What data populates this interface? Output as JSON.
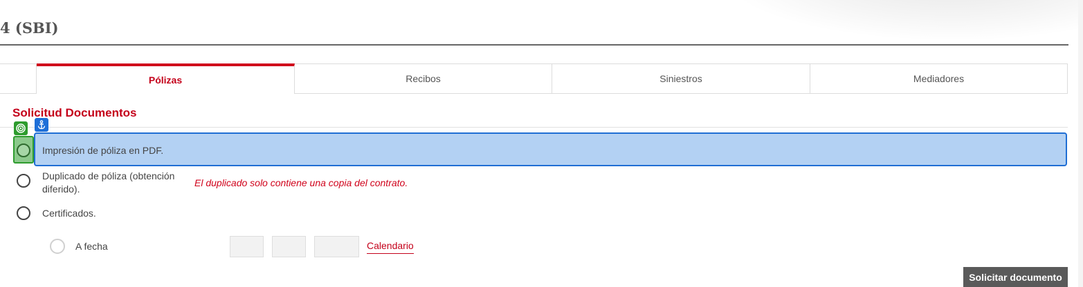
{
  "page": {
    "title": "4 (SBI)"
  },
  "tabs": [
    {
      "label": "Pólizas",
      "active": true
    },
    {
      "label": "Recibos",
      "active": false
    },
    {
      "label": "Siniestros",
      "active": false
    },
    {
      "label": "Mediadores",
      "active": false
    }
  ],
  "section": {
    "title": "Solicitud Documentos"
  },
  "options": [
    {
      "label": "Impresión de póliza en PDF.",
      "selected": false
    },
    {
      "label_line1": "Duplicado de póliza (obtención",
      "label_line2": "diferido).",
      "note": "El duplicado solo contiene una copia del contrato."
    },
    {
      "label": "Certificados."
    }
  ],
  "date_option": {
    "label": "A fecha",
    "calendar_link": "Calendario"
  },
  "actions": {
    "submit_label": "Solicitar documento"
  },
  "overlay": {
    "target_icon": "target-icon",
    "anchor_icon": "anchor-icon"
  },
  "colors": {
    "accent_red": "#c4001a",
    "highlight_blue": "#b3d1f3",
    "highlight_border": "#1f6ed4",
    "marker_green": "#2e9c2e"
  }
}
